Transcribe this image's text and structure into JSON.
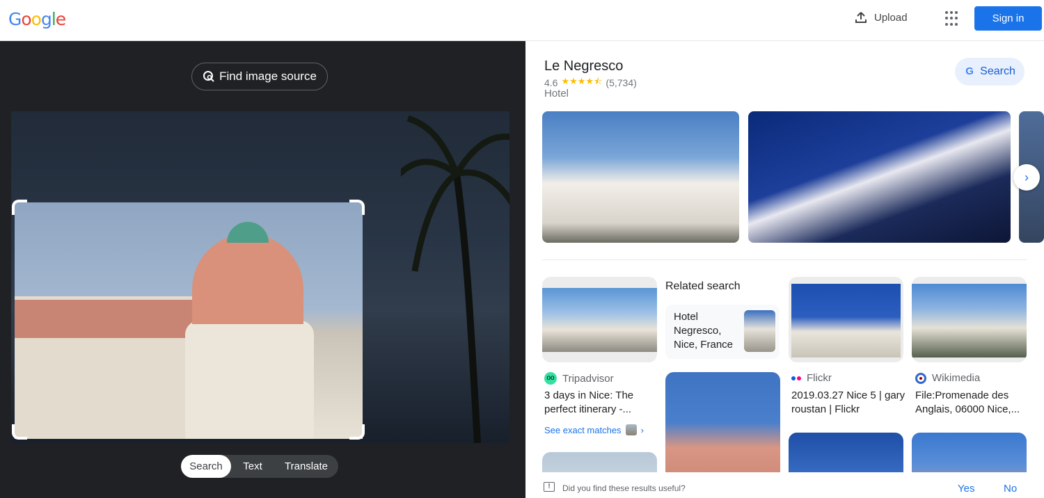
{
  "header": {
    "logo_letters": [
      {
        "char": "G",
        "color": "#4285f4"
      },
      {
        "char": "o",
        "color": "#ea4335"
      },
      {
        "char": "o",
        "color": "#fbbc05"
      },
      {
        "char": "g",
        "color": "#4285f4"
      },
      {
        "char": "l",
        "color": "#34a853"
      },
      {
        "char": "e",
        "color": "#ea4335"
      }
    ],
    "upload_label": "Upload",
    "upload_icon": "upload-icon",
    "apps_icon": "apps-grid-icon",
    "signin_label": "Sign in"
  },
  "lens": {
    "find_source_label": "Find image source",
    "find_source_icon": "image-search-icon",
    "modes": [
      {
        "label": "Search",
        "active": true
      },
      {
        "label": "Text",
        "active": false
      },
      {
        "label": "Translate",
        "active": false
      }
    ]
  },
  "knowledge_panel": {
    "title": "Le Negresco",
    "rating": "4.6",
    "stars": "★★★★⯪",
    "rating_value": 4.6,
    "review_count": "(5,734)",
    "type": "Hotel",
    "search_label": "Search",
    "next_icon": "›"
  },
  "results": {
    "related_heading": "Related search",
    "related_query": "Hotel Negresco, Nice, France",
    "items": [
      {
        "source": "Tripadvisor",
        "title": "3 days in Nice: The perfect itinerary -..."
      },
      {
        "source": "Flickr",
        "title": "2019.03.27 Nice 5 | gary roustan | Flickr"
      },
      {
        "source": "Wikimedia",
        "title": "File:Promenade des Anglais, 06000 Nice,..."
      }
    ],
    "see_exact_matches": "See exact matches",
    "chevron": "›"
  },
  "feedback": {
    "question": "Did you find these results useful?",
    "yes": "Yes",
    "no": "No"
  },
  "colors": {
    "accent": "#1a73e8",
    "dark_bg": "#202124",
    "star": "#fbbc04"
  }
}
